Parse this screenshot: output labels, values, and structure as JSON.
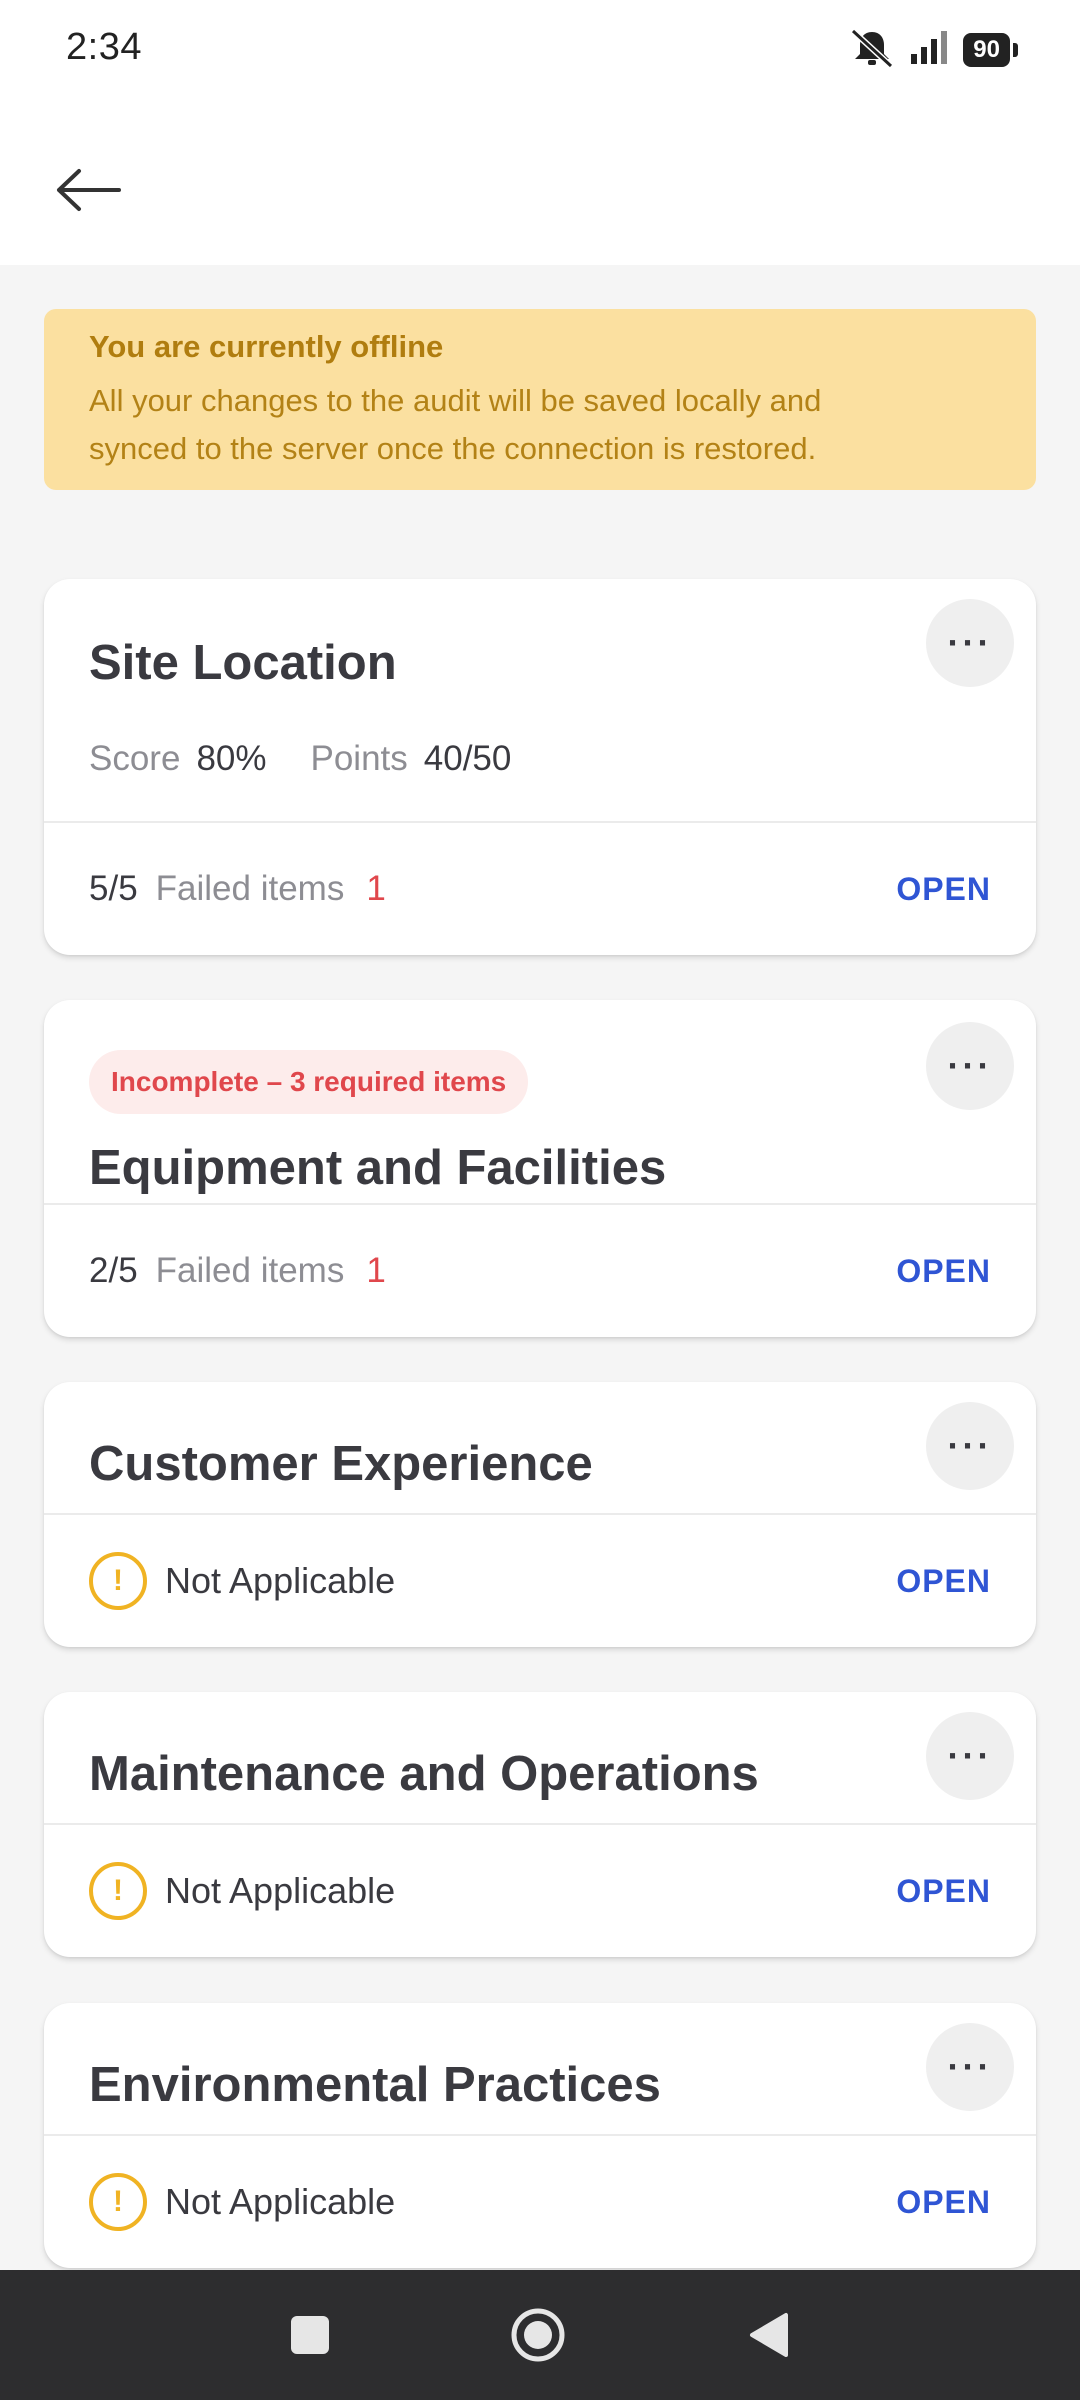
{
  "status": {
    "time": "2:34",
    "battery": "90"
  },
  "banner": {
    "title": "You are currently offline",
    "message_line1": "All your changes to the audit will be saved locally and",
    "message_line2": "synced to the server once the connection is restored."
  },
  "sections": [
    {
      "title": "Site Location",
      "score_label": "Score",
      "score_value": "80%",
      "points_label": "Points",
      "points_value": "40/50",
      "count": "5/5",
      "failed_label": "Failed items",
      "failed_count": "1",
      "action": "OPEN"
    },
    {
      "badge": "Incomplete – 3 required items",
      "title": "Equipment and Facilities",
      "count": "2/5",
      "failed_label": "Failed items",
      "failed_count": "1",
      "action": "OPEN"
    },
    {
      "title": "Customer Experience",
      "status": "Not Applicable",
      "action": "OPEN"
    },
    {
      "title": "Maintenance and Operations",
      "status": "Not Applicable",
      "action": "OPEN"
    },
    {
      "title": "Environmental Practices",
      "status": "Not Applicable",
      "action": "OPEN"
    }
  ],
  "more_glyph": "···",
  "warn_glyph": "!",
  "colors": {
    "accent": "#2f55d4",
    "danger": "#e0474c",
    "warning": "#f0b323",
    "banner_bg": "#fbe0a0",
    "banner_text": "#b38216"
  }
}
